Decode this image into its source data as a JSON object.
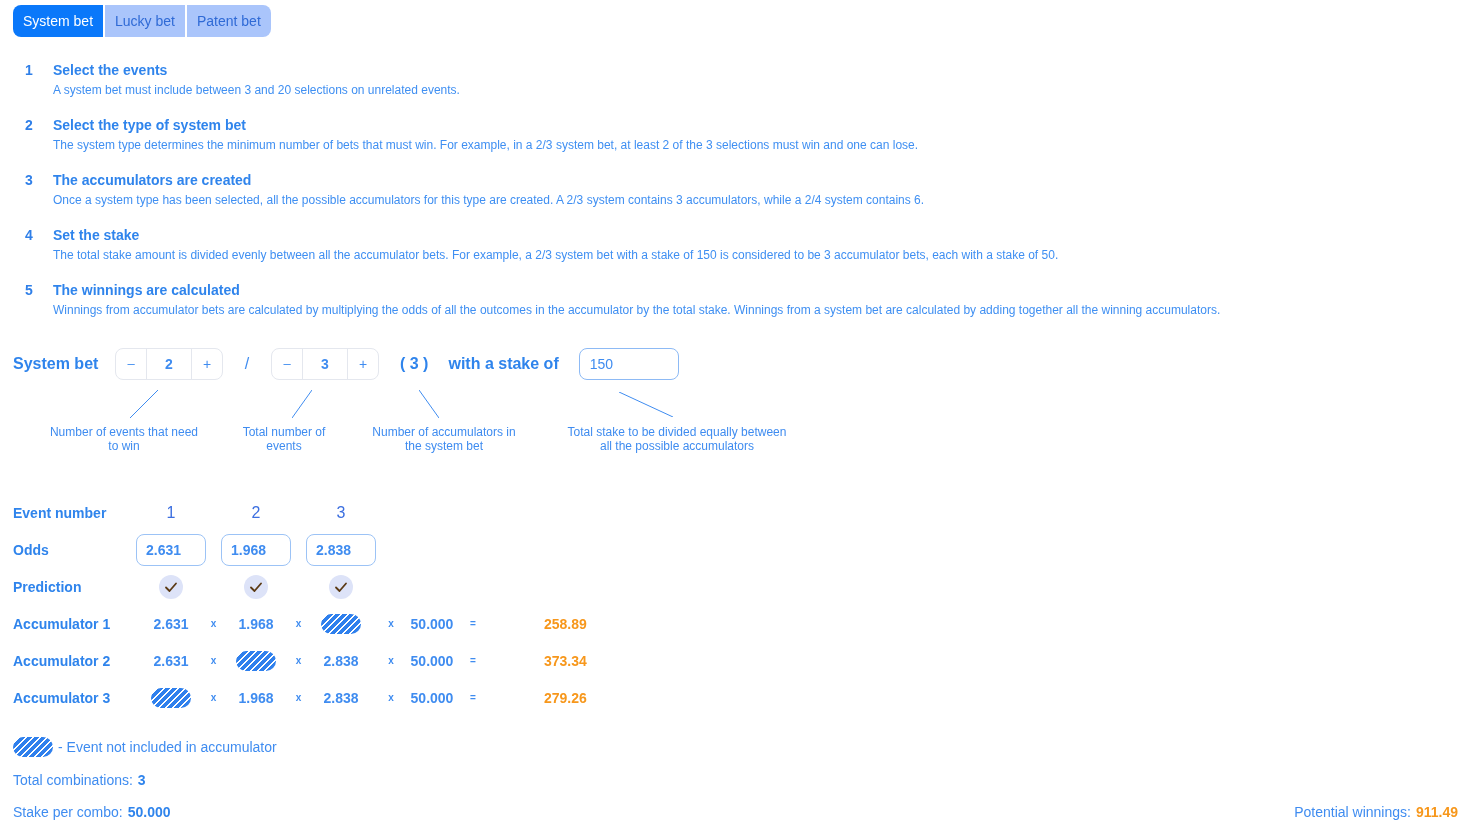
{
  "tabs": [
    {
      "label": "System bet",
      "selected": true
    },
    {
      "label": "Lucky bet",
      "selected": false
    },
    {
      "label": "Patent bet",
      "selected": false
    }
  ],
  "steps": [
    {
      "number": "1",
      "title": "Select the events",
      "description": "A system bet must include between 3 and 20 selections on unrelated events."
    },
    {
      "number": "2",
      "title": "Select the type of system bet",
      "description": "The system type determines the minimum number of bets that must win. For example, in a 2/3 system bet, at least 2 of the 3 selections must win and one can lose."
    },
    {
      "number": "3",
      "title": "The accumulators are created",
      "description": "Once a system type has been selected, all the possible accumulators for this type are created. A 2/3 system contains 3 accumulators, while a 2/4 system contains 6."
    },
    {
      "number": "4",
      "title": "Set the stake",
      "description": "The total stake amount is divided evenly between all the accumulator bets. For example, a 2/3 system bet with a stake of 150 is considered to be 3 accumulator bets, each with a stake of 50."
    },
    {
      "number": "5",
      "title": "The winnings are calculated",
      "description": "Winnings from accumulator bets are calculated by multiplying the odds of all the outcomes in the accumulator by the total stake. Winnings from a system bet are calculated by adding together all the winning accumulators."
    }
  ],
  "system_bet": {
    "label": "System bet",
    "events_to_win": {
      "decrement": "–",
      "value": "2",
      "increment": "+"
    },
    "separator": "/",
    "total_events": {
      "decrement": "–",
      "value": "3",
      "increment": "+"
    },
    "accumulator_count": "( 3 )",
    "stake_label": "with a stake of",
    "stake": {
      "value": "150"
    }
  },
  "annotations": [
    "Number of events that need to win",
    "Total number of events",
    "Number of accumulators in the system bet",
    "Total stake to be divided equally between all the possible accumulators"
  ],
  "event_table": {
    "event_number_label": "Event number",
    "event_numbers": [
      "1",
      "2",
      "3"
    ],
    "odds_label": "Odds",
    "odds": [
      "2.631",
      "1.968",
      "2.838"
    ],
    "prediction_label": "Prediction",
    "predictions": [
      {
        "checked": true
      },
      {
        "checked": true
      },
      {
        "checked": true
      }
    ],
    "accumulators": [
      {
        "label": "Accumulator 1",
        "items": [
          {
            "kind": "odds",
            "text": "2.631"
          },
          {
            "kind": "operator",
            "text": "x"
          },
          {
            "kind": "odds",
            "text": "1.968"
          },
          {
            "kind": "operator",
            "text": "x"
          },
          {
            "kind": "excluded"
          },
          {
            "kind": "operator",
            "text": "x"
          },
          {
            "kind": "stake",
            "text": "50.000"
          },
          {
            "kind": "operator",
            "text": "="
          },
          {
            "kind": "result",
            "text": "258.89"
          }
        ]
      },
      {
        "label": "Accumulator 2",
        "items": [
          {
            "kind": "odds",
            "text": "2.631"
          },
          {
            "kind": "operator",
            "text": "x"
          },
          {
            "kind": "excluded"
          },
          {
            "kind": "operator",
            "text": "x"
          },
          {
            "kind": "odds",
            "text": "2.838"
          },
          {
            "kind": "operator",
            "text": "x"
          },
          {
            "kind": "stake",
            "text": "50.000"
          },
          {
            "kind": "operator",
            "text": "="
          },
          {
            "kind": "result",
            "text": "373.34"
          }
        ]
      },
      {
        "label": "Accumulator 3",
        "items": [
          {
            "kind": "excluded"
          },
          {
            "kind": "operator",
            "text": "x"
          },
          {
            "kind": "odds",
            "text": "1.968"
          },
          {
            "kind": "operator",
            "text": "x"
          },
          {
            "kind": "odds",
            "text": "2.838"
          },
          {
            "kind": "operator",
            "text": "x"
          },
          {
            "kind": "stake",
            "text": "50.000"
          },
          {
            "kind": "operator",
            "text": "="
          },
          {
            "kind": "result",
            "text": "279.26"
          }
        ]
      }
    ]
  },
  "legend": {
    "text": "- Event not included in accumulator"
  },
  "totals": {
    "combinations": {
      "label": "Total combinations:",
      "value": "3"
    },
    "stake_per_combo": {
      "label": "Stake per combo:",
      "value": "50.000"
    },
    "potential_winnings": {
      "label": "Potential winnings:",
      "value": "911.49"
    }
  }
}
